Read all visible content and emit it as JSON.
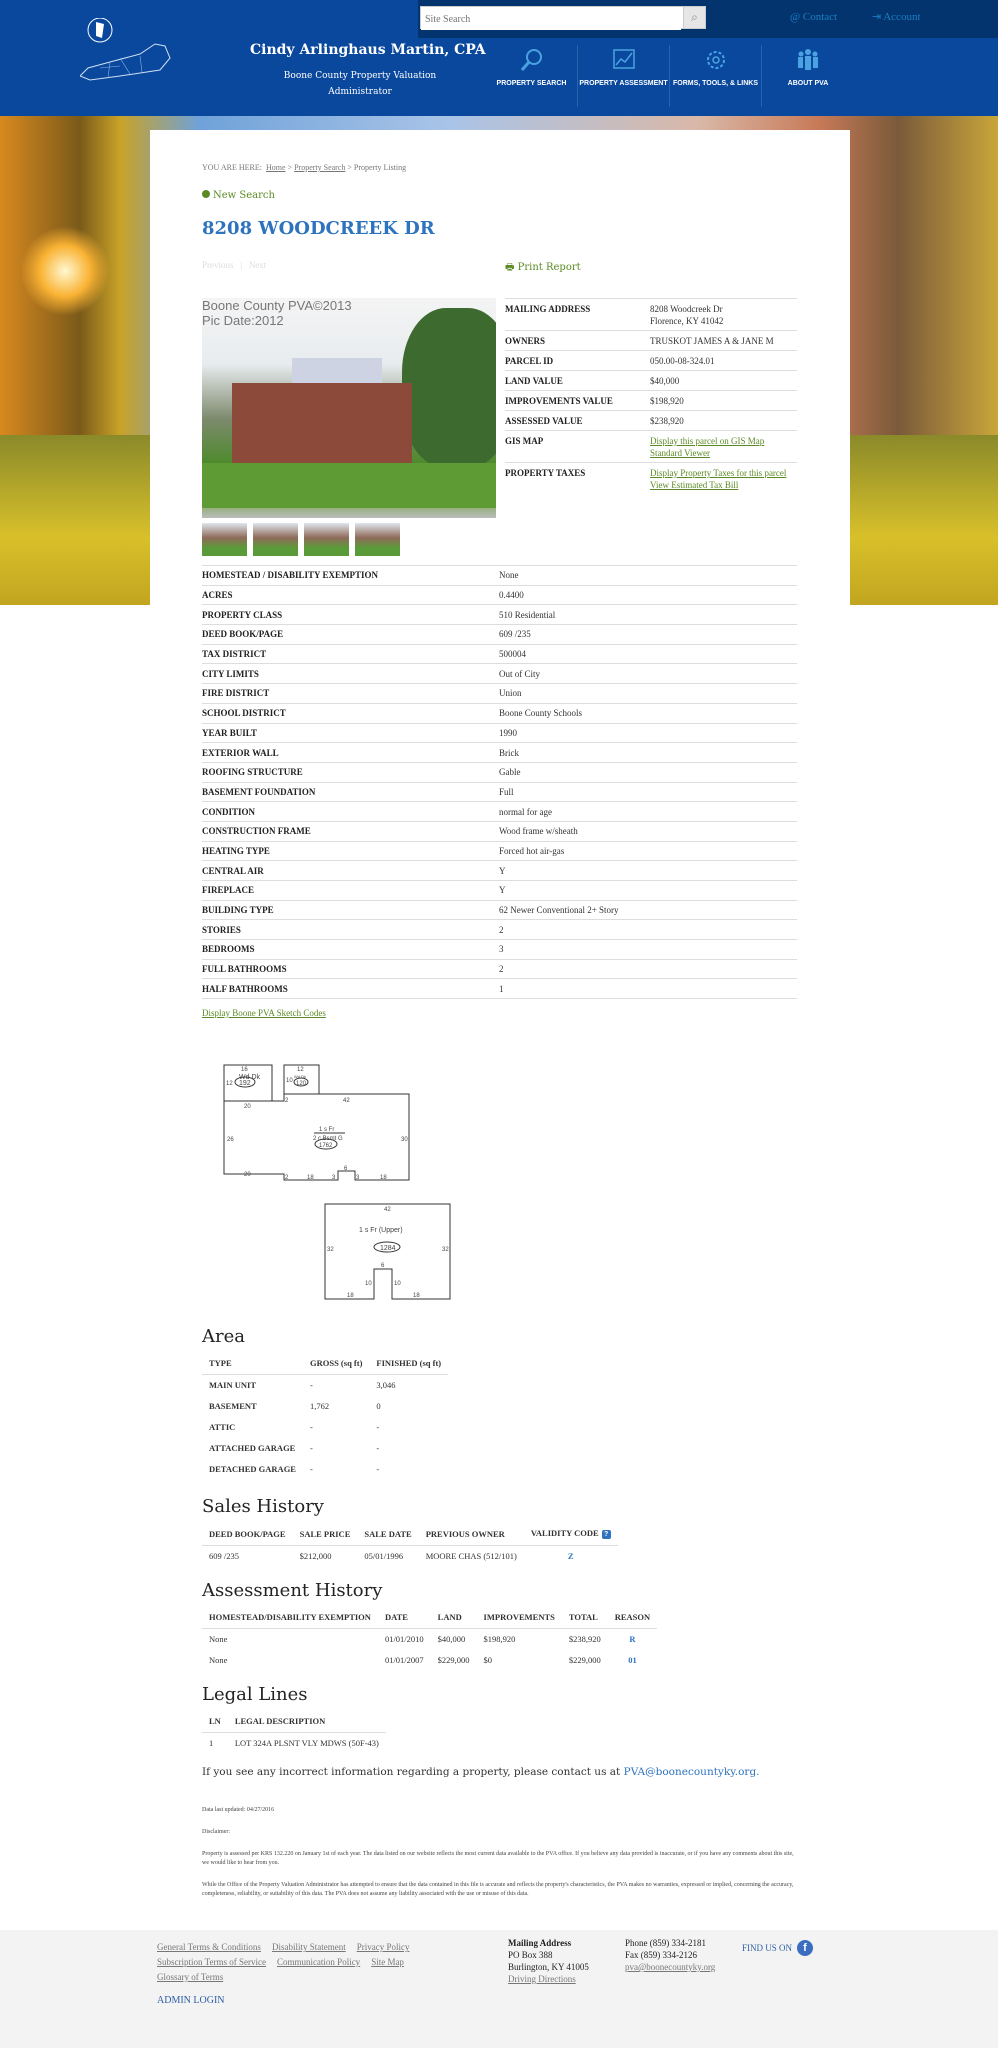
{
  "header": {
    "search_placeholder": "Site Search",
    "contact": "Contact",
    "account": "Account",
    "name": "Cindy Arlinghaus Martin, CPA",
    "subtitle": "Boone County Property Valuation Administrator",
    "nav": [
      {
        "label": "PROPERTY SEARCH",
        "icon": "magnifier-icon"
      },
      {
        "label": "PROPERTY ASSESSMENT",
        "icon": "chart-icon"
      },
      {
        "label": "FORMS, TOOLS, & LINKS",
        "icon": "gear-icon"
      },
      {
        "label": "ABOUT PVA",
        "icon": "people-icon"
      }
    ],
    "colors": {
      "header": "#0a489d",
      "topbar": "#03346e"
    }
  },
  "breadcrumb": {
    "prefix": "YOU ARE HERE:",
    "items": [
      "Home",
      "Property Search",
      "Property Listing"
    ]
  },
  "new_search": "New Search",
  "title": "8208 WOODCREEK DR",
  "pager": {
    "previous": "Previous",
    "next": "Next"
  },
  "print_report": "Print Report",
  "photo": {
    "watermark1": "Boone County PVA©2013",
    "watermark2": "Pic Date:2012"
  },
  "summary": {
    "mailing_label": "MAILING ADDRESS",
    "mailing_1": "8208 Woodcreek Dr",
    "mailing_2": "Florence, KY 41042",
    "owners_label": "OWNERS",
    "owners": "TRUSKOT JAMES A & JANE M",
    "parcel_label": "PARCEL ID",
    "parcel": "050.00-08-324.01",
    "land_label": "LAND VALUE",
    "land": "$40,000",
    "impr_label": "IMPROVEMENTS VALUE",
    "impr": "$198,920",
    "assessed_label": "ASSESSED VALUE",
    "assessed": "$238,920",
    "gis_label": "GIS MAP",
    "gis_link": "Display this parcel on GIS Map Standard Viewer",
    "taxes_label": "PROPERTY TAXES",
    "taxes_link": "Display Property Taxes for this parcel",
    "tax_bill_link": "View Estimated Tax Bill"
  },
  "details": [
    [
      "HOMESTEAD / DISABILITY EXEMPTION",
      "None"
    ],
    [
      "ACRES",
      "0.4400"
    ],
    [
      "PROPERTY CLASS",
      "510 Residential"
    ],
    [
      "DEED BOOK/PAGE",
      "609 /235"
    ],
    [
      "TAX DISTRICT",
      "500004"
    ],
    [
      "CITY LIMITS",
      "Out of City"
    ],
    [
      "FIRE DISTRICT",
      "Union"
    ],
    [
      "SCHOOL DISTRICT",
      "Boone County Schools"
    ],
    [
      "YEAR BUILT",
      "1990"
    ],
    [
      "EXTERIOR WALL",
      "Brick"
    ],
    [
      "ROOFING STRUCTURE",
      "Gable"
    ],
    [
      "BASEMENT FOUNDATION",
      "Full"
    ],
    [
      "CONDITION",
      "normal for age"
    ],
    [
      "CONSTRUCTION FRAME",
      "Wood frame w/sheath"
    ],
    [
      "HEATING TYPE",
      "Forced hot air-gas"
    ],
    [
      "CENTRAL AIR",
      "Y"
    ],
    [
      "FIREPLACE",
      "Y"
    ],
    [
      "BUILDING TYPE",
      "62 Newer Conventional 2+ Story"
    ],
    [
      "STORIES",
      "2"
    ],
    [
      "BEDROOMS",
      "3"
    ],
    [
      "FULL BATHROOMS",
      "2"
    ],
    [
      "HALF BATHROOMS",
      "1"
    ]
  ],
  "sketch_link": "Display Boone PVA Sketch Codes",
  "sketch": {
    "deck1": "Wd Dk",
    "deck1_area": "192",
    "deck2": "Wd Dk",
    "deck2_area": "120",
    "main_top": "1 s Fr",
    "main_bottom": "2 c Bsmt G",
    "main_area": "1762",
    "upper": "1 s Fr  (Upper)",
    "upper_area": "1284",
    "dims": {
      "d16": "16",
      "d12a": "12",
      "d12b": "12",
      "d10": "10",
      "d20a": "20",
      "d2a": "2",
      "d42a": "42",
      "d26": "26",
      "d30": "30",
      "d20b": "20",
      "d2b": "2",
      "d18a": "18",
      "d3a": "3",
      "d6a": "6",
      "d3b": "3",
      "d18b": "18",
      "d42b": "42",
      "d32a": "32",
      "d32b": "32",
      "d6b": "6",
      "d10a": "10",
      "d10b": "10",
      "d18c": "18",
      "d18d": "18"
    }
  },
  "area": {
    "heading": "Area",
    "headers": [
      "TYPE",
      "GROSS (sq ft)",
      "FINISHED (sq ft)"
    ],
    "rows": [
      [
        "MAIN UNIT",
        "-",
        "3,046"
      ],
      [
        "BASEMENT",
        "1,762",
        "0"
      ],
      [
        "ATTIC",
        "-",
        "-"
      ],
      [
        "ATTACHED GARAGE",
        "-",
        "-"
      ],
      [
        "DETACHED GARAGE",
        "-",
        "-"
      ]
    ]
  },
  "sales": {
    "heading": "Sales History",
    "headers": [
      "DEED BOOK/PAGE",
      "SALE PRICE",
      "SALE DATE",
      "PREVIOUS OWNER",
      "VALIDITY CODE"
    ],
    "rows": [
      [
        "609 /235",
        "$212,000",
        "05/01/1996",
        "MOORE CHAS (512/101)",
        "Z"
      ]
    ]
  },
  "assessment": {
    "heading": "Assessment History",
    "headers": [
      "HOMESTEAD/DISABILITY EXEMPTION",
      "DATE",
      "LAND",
      "IMPROVEMENTS",
      "TOTAL",
      "REASON"
    ],
    "rows": [
      [
        "None",
        "01/01/2010",
        "$40,000",
        "$198,920",
        "$238,920",
        "R"
      ],
      [
        "None",
        "01/01/2007",
        "$229,000",
        "$0",
        "$229,000",
        "01"
      ]
    ]
  },
  "legal": {
    "heading": "Legal Lines",
    "headers": [
      "LN",
      "LEGAL DESCRIPTION"
    ],
    "rows": [
      [
        "1",
        "LOT 324A PLSNT VLY MDWS (50F-43)"
      ]
    ]
  },
  "contact_text": "If you see any incorrect information regarding a property, please contact us at",
  "contact_email": "PVA@boonecountyky.org.",
  "updated": "Data last updated: 04/27/2016",
  "disclaimer_label": "Disclaimer:",
  "disclaimer_1": "Property is assessed per KRS 132.220 on January 1st of each year. The data listed on our website reflects the most current data available to the PVA office. If you believe any data provided is inaccurate, or if you have any comments about this site, we would like to hear from you.",
  "disclaimer_2": "While the Office of the Property Valuation Administrator has attempted to ensure that the data contained in this file is accurate and reflects the property's characteristics, the PVA makes no warranties, expressed or implied, concerning the accuracy, completeness, reliability, or suitability of this data. The PVA does not assume any liability associated with the use or misuse of this data.",
  "footer": {
    "links": [
      "General Terms & Conditions",
      "Disability Statement",
      "Privacy Policy",
      "Subscription Terms of Service",
      "Communication Policy",
      "Site Map",
      "Glossary of Terms"
    ],
    "admin": "ADMIN LOGIN",
    "addr_title": "Mailing Address",
    "addr_1": "PO Box 388",
    "addr_2": "Burlington, KY 41005",
    "directions": "Driving Directions",
    "phone": "Phone (859) 334-2181",
    "fax": "Fax (859) 334-2126",
    "email": "pva@boonecountyky.org",
    "find_us": "FIND US ON"
  }
}
